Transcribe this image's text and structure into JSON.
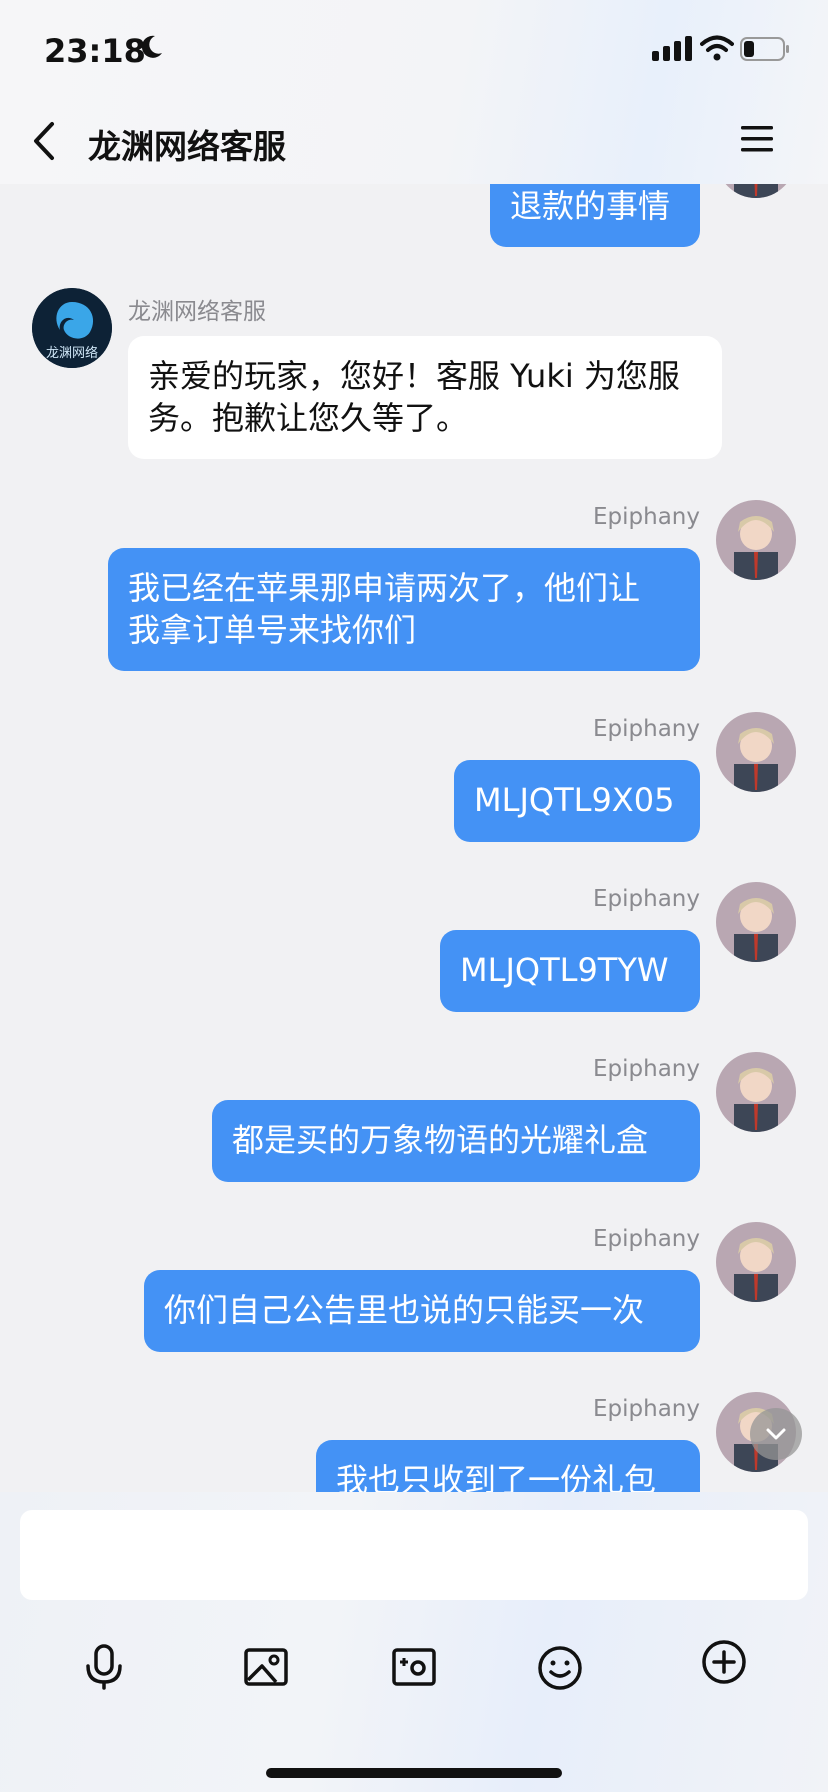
{
  "status": {
    "time": "23:18"
  },
  "header": {
    "title": "龙渊网络客服"
  },
  "messages": [
    {
      "side": "out",
      "text_lines": [
        "退款的事情"
      ]
    },
    {
      "side": "in",
      "sender": "龙渊网络客服",
      "avatar_text": "龙渊网络",
      "text_lines": [
        "亲爱的玩家，您好！客服 Yuki 为您服",
        "务。抱歉让您久等了。"
      ]
    },
    {
      "side": "out",
      "sender": "Epiphany",
      "text_lines": [
        "我已经在苹果那申请两次了，他们让",
        "我拿订单号来找你们"
      ]
    },
    {
      "side": "out",
      "sender": "Epiphany",
      "text_lines": [
        "MLJQTL9X05"
      ]
    },
    {
      "side": "out",
      "sender": "Epiphany",
      "text_lines": [
        "MLJQTL9TYW"
      ]
    },
    {
      "side": "out",
      "sender": "Epiphany",
      "text_lines": [
        "都是买的万象物语的光耀礼盒"
      ]
    },
    {
      "side": "out",
      "sender": "Epiphany",
      "text_lines": [
        "你们自己公告里也说的只能买一次"
      ]
    },
    {
      "side": "out",
      "sender": "Epiphany",
      "text_lines": [
        "我也只收到了一份礼包"
      ]
    }
  ],
  "composer": {
    "value": ""
  },
  "toolbar": [
    "microphone-icon",
    "image-icon",
    "camera-icon",
    "emoji-icon",
    "plus-icon"
  ],
  "colors": {
    "outgoing_bubble": "#4492f5",
    "incoming_bubble": "#ffffff",
    "background": "#f1f1f3"
  }
}
